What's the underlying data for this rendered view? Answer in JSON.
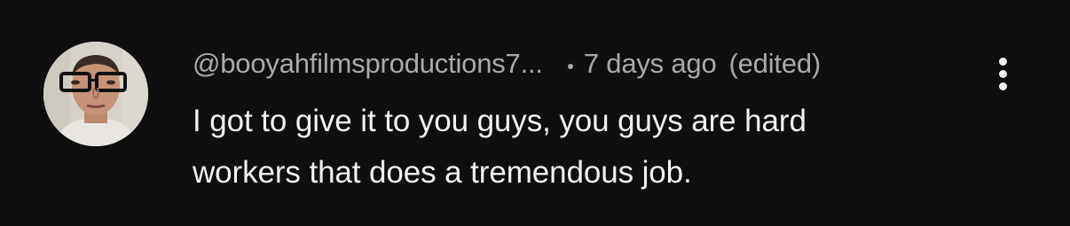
{
  "comment": {
    "author_handle": "@booyahfilmsproductions7...",
    "separator": "•",
    "timestamp": "7 days ago",
    "edited_label": "(edited)",
    "text_lines": [
      "I got to give it to you guys, you guys are hard",
      "workers that does a tremendous job."
    ],
    "avatar_icon": "user-avatar-photo",
    "menu_icon": "more-vertical-icon"
  },
  "colors": {
    "background": "#0f0f0f",
    "primary_text": "#f1f1f1",
    "secondary_text": "#aaaaaa"
  }
}
